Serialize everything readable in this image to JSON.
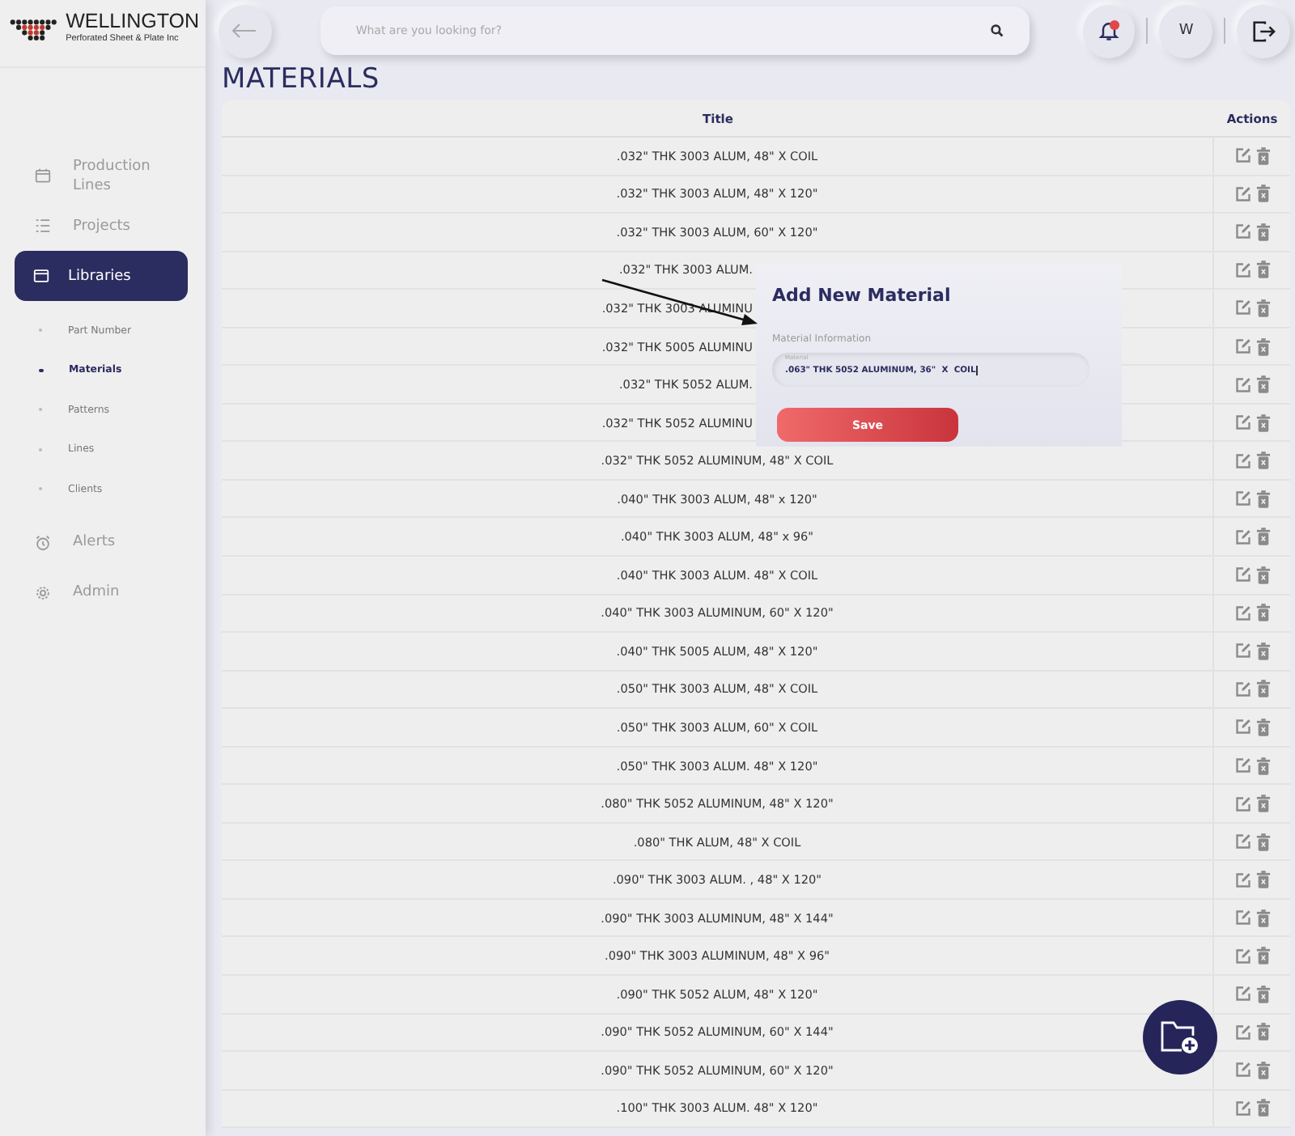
{
  "sidebar": {
    "brand": "WELLINGTON",
    "tagline": "Perforated Sheet & Plate Inc",
    "items": [
      {
        "label": "Production Lines",
        "selected": false
      },
      {
        "label": "Projects",
        "selected": false
      },
      {
        "label": "Libraries",
        "selected": true,
        "children": [
          {
            "label": "Part Number",
            "selected": false
          },
          {
            "label": "Materials",
            "selected": true
          },
          {
            "label": "Patterns",
            "selected": false
          },
          {
            "label": "Lines",
            "selected": false
          },
          {
            "label": "Clients",
            "selected": false
          }
        ]
      },
      {
        "label": "Alerts",
        "selected": false
      },
      {
        "label": "Admin",
        "selected": false
      }
    ]
  },
  "topbar": {
    "search": {
      "placeholder": "What are you looking for?"
    },
    "user": "W"
  },
  "page_title": "MATERIALS",
  "table": {
    "columns": [
      "Title",
      "Actions"
    ],
    "rows": [
      {
        "title": ".032\" THK 3003 ALUM, 48\" X COIL"
      },
      {
        "title": ".032\" THK 3003 ALUM, 48\" X 120\""
      },
      {
        "title": ".032\" THK 3003 ALUM, 60\" X 120\""
      },
      {
        "title": ".032\" THK 3003 ALUM."
      },
      {
        "title": ".032\" THK 3003 ALUMINU"
      },
      {
        "title": ".032\" THK 5005 ALUMINU"
      },
      {
        "title": ".032\" THK 5052 ALUM."
      },
      {
        "title": ".032\" THK 5052 ALUMINU"
      },
      {
        "title": ".032\" THK 5052 ALUMINUM, 48\" X COIL"
      },
      {
        "title": ".040\" THK 3003 ALUM, 48\" x 120\""
      },
      {
        "title": ".040\" THK 3003 ALUM, 48\" x 96\""
      },
      {
        "title": ".040\" THK 3003 ALUM. 48\" X COIL"
      },
      {
        "title": ".040\" THK 3003 ALUMINUM, 60\" X 120\""
      },
      {
        "title": ".040\" THK 5005 ALUM, 48\" X 120\""
      },
      {
        "title": ".050\" THK 3003 ALUM, 48\" X COIL"
      },
      {
        "title": ".050\" THK 3003 ALUM, 60\" X COIL"
      },
      {
        "title": ".050\" THK 3003 ALUM. 48\" X 120\""
      },
      {
        "title": ".080\" THK 5052 ALUMINUM, 48\" X 120\""
      },
      {
        "title": ".080\" THK ALUM, 48\" X COIL"
      },
      {
        "title": ".090\" THK 3003 ALUM. , 48\" X 120\""
      },
      {
        "title": ".090\" THK 3003 ALUMINUM, 48\" X 144\""
      },
      {
        "title": ".090\" THK 3003 ALUMINUM, 48\" X 96\""
      },
      {
        "title": ".090\" THK 5052 ALUM, 48\" X 120\""
      },
      {
        "title": ".090\" THK 5052 ALUMINUM, 60\" X 144\""
      },
      {
        "title": ".090\" THK 5052 ALUMINUM, 60\" X 120\""
      },
      {
        "title": ".100\" THK 3003 ALUM. 48\" X 120\""
      }
    ]
  },
  "dialog": {
    "title": "Add New Material",
    "section_label": "Material Information",
    "field": {
      "label": "Material",
      "value": ".063\" THK 5052 ALUMINUM, 36\"  X  COIL"
    },
    "button": "Save"
  }
}
